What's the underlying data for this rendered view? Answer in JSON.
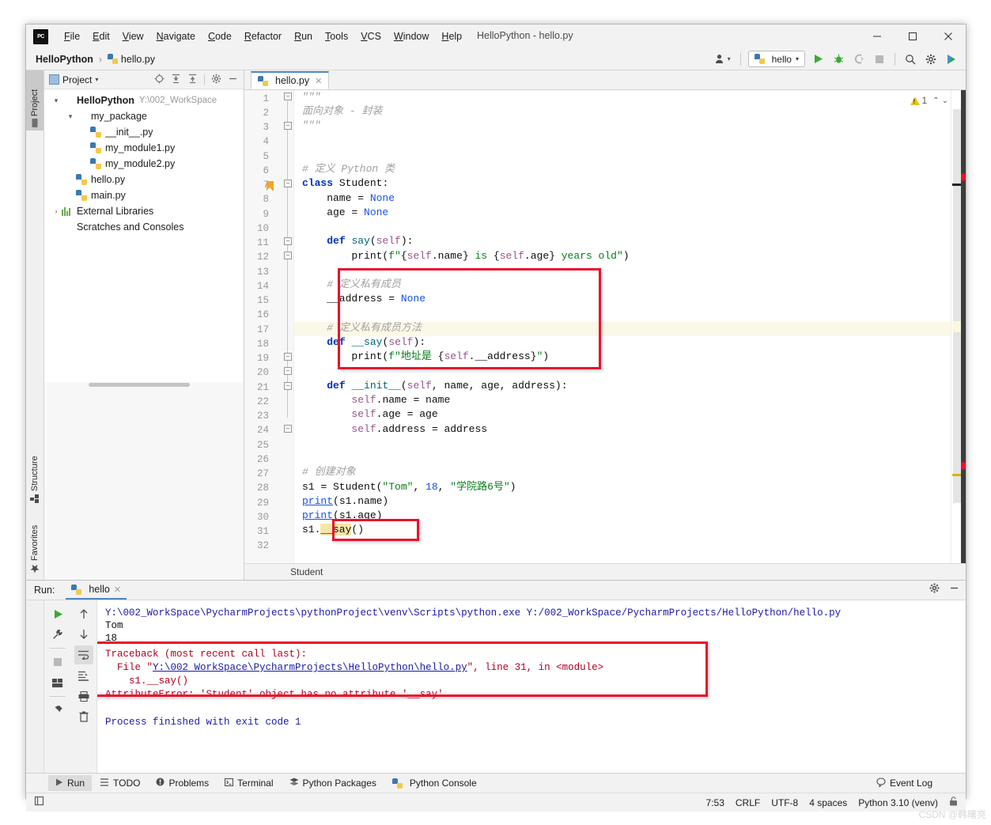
{
  "window": {
    "title": "HelloPython - hello.py",
    "logo": "pycharm-logo",
    "minimize": "–",
    "maximize": "□",
    "close": "✕"
  },
  "menubar": {
    "items": [
      "File",
      "Edit",
      "View",
      "Navigate",
      "Code",
      "Refactor",
      "Run",
      "Tools",
      "VCS",
      "Window",
      "Help"
    ]
  },
  "breadcrumb": {
    "project": "HelloPython",
    "separator": "›",
    "file": "hello.py"
  },
  "toolbar": {
    "run_config": "hello",
    "user_icon": "user-icon",
    "dropdown_caret": "▾",
    "run_icon": "run-icon",
    "debug_icon": "debug-icon",
    "coverage_icon": "run-coverage-icon",
    "stop_icon": "stop-icon",
    "search_icon": "search-icon",
    "settings_icon": "gear-icon",
    "ai_icon": "ai-assistant-icon"
  },
  "left_tool_strip": {
    "tabs": [
      {
        "label": "Project",
        "icon": "folder-icon",
        "selected": true
      },
      {
        "label": "Structure",
        "icon": "structure-icon",
        "selected": false
      },
      {
        "label": "Favorites",
        "icon": "star-icon",
        "selected": false
      }
    ]
  },
  "project_panel": {
    "title": "Project",
    "caret": "▾",
    "tools": [
      "locate-icon",
      "expand-all-icon",
      "collapse-all-icon",
      "gear-icon",
      "hide-icon"
    ],
    "tree": [
      {
        "label": "HelloPython",
        "path": "Y:\\002_WorkSpace",
        "icon": "folder-icon",
        "arrow": "▾",
        "depth": 0,
        "bold": true
      },
      {
        "label": "my_package",
        "path": "",
        "icon": "package-icon",
        "arrow": "▾",
        "depth": 1,
        "bold": false
      },
      {
        "label": "__init__.py",
        "path": "",
        "icon": "python-file-icon",
        "arrow": "",
        "depth": 2,
        "bold": false
      },
      {
        "label": "my_module1.py",
        "path": "",
        "icon": "python-file-icon",
        "arrow": "",
        "depth": 2,
        "bold": false
      },
      {
        "label": "my_module2.py",
        "path": "",
        "icon": "python-file-icon",
        "arrow": "",
        "depth": 2,
        "bold": false
      },
      {
        "label": "hello.py",
        "path": "",
        "icon": "python-file-icon",
        "arrow": "",
        "depth": 1,
        "bold": false
      },
      {
        "label": "main.py",
        "path": "",
        "icon": "python-file-icon",
        "arrow": "",
        "depth": 1,
        "bold": false
      },
      {
        "label": "External Libraries",
        "path": "",
        "icon": "libraries-icon",
        "arrow": "›",
        "depth": 0,
        "bold": false
      },
      {
        "label": "Scratches and Consoles",
        "path": "",
        "icon": "scratches-icon",
        "arrow": "",
        "depth": 0,
        "bold": false
      }
    ]
  },
  "editor": {
    "tab": {
      "label": "hello.py",
      "icon": "python-file-icon",
      "close": "✕"
    },
    "inspection": {
      "count": "1",
      "icon": "warning-triangle-icon",
      "up": "⌃",
      "down": "⌄"
    },
    "breadcrumb": "Student",
    "bookmark_line": 7,
    "highlight_line": 17,
    "lines": [
      {
        "n": 1,
        "text": "\"\"\""
      },
      {
        "n": 2,
        "text": "面向对象 - 封装"
      },
      {
        "n": 3,
        "text": "\"\"\""
      },
      {
        "n": 4,
        "text": ""
      },
      {
        "n": 5,
        "text": ""
      },
      {
        "n": 6,
        "text": "# 定义 Python 类"
      },
      {
        "n": 7,
        "text": "class Student:"
      },
      {
        "n": 8,
        "text": "    name = None"
      },
      {
        "n": 9,
        "text": "    age = None"
      },
      {
        "n": 10,
        "text": ""
      },
      {
        "n": 11,
        "text": "    def say(self):"
      },
      {
        "n": 12,
        "text": "        print(f\"{self.name} is {self.age} years old\")"
      },
      {
        "n": 13,
        "text": ""
      },
      {
        "n": 14,
        "text": "    # 定义私有成员"
      },
      {
        "n": 15,
        "text": "    __address = None"
      },
      {
        "n": 16,
        "text": ""
      },
      {
        "n": 17,
        "text": "    # 定义私有成员方法"
      },
      {
        "n": 18,
        "text": "    def __say(self):"
      },
      {
        "n": 19,
        "text": "        print(f\"地址是 {self.__address}\")"
      },
      {
        "n": 20,
        "text": ""
      },
      {
        "n": 21,
        "text": "    def __init__(self, name, age, address):"
      },
      {
        "n": 22,
        "text": "        self.name = name"
      },
      {
        "n": 23,
        "text": "        self.age = age"
      },
      {
        "n": 24,
        "text": "        self.address = address"
      },
      {
        "n": 25,
        "text": ""
      },
      {
        "n": 26,
        "text": ""
      },
      {
        "n": 27,
        "text": "# 创建对象"
      },
      {
        "n": 28,
        "text": "s1 = Student(\"Tom\", 18, \"学院路6号\")"
      },
      {
        "n": 29,
        "text": "print(s1.name)"
      },
      {
        "n": 30,
        "text": "print(s1.age)"
      },
      {
        "n": 31,
        "text": "s1.__say()"
      },
      {
        "n": 32,
        "text": ""
      }
    ]
  },
  "run_panel": {
    "label": "Run:",
    "tab": {
      "label": "hello",
      "icon": "python-icon",
      "close": "✕"
    },
    "header_tools": [
      "gear-icon",
      "hide-icon"
    ],
    "left_tools": [
      "rerun-icon",
      "wrench-icon",
      "stop-icon",
      "layout-icon",
      "pin-icon"
    ],
    "right_tools": [
      "up-arrow-icon",
      "down-arrow-icon",
      "soft-wrap-icon",
      "scroll-to-end-icon",
      "print-icon",
      "trash-icon"
    ],
    "console": [
      {
        "text": "Y:\\002_WorkSpace\\PycharmProjects\\pythonProject\\venv\\Scripts\\python.exe Y:/002_WorkSpace/PycharmProjects/HelloPython/hello.py",
        "style": "blue"
      },
      {
        "text": "Tom",
        "style": "plain"
      },
      {
        "text": "18",
        "style": "plain"
      },
      {
        "text": "Traceback (most recent call last):",
        "style": "red"
      },
      {
        "text": "  File \"Y:\\002_WorkSpace\\PycharmProjects\\HelloPython\\hello.py\", line 31, in <module>",
        "style": "red-link"
      },
      {
        "text": "    s1.__say()",
        "style": "red"
      },
      {
        "text": "AttributeError: 'Student' object has no attribute '__say'",
        "style": "red"
      },
      {
        "text": "",
        "style": "plain"
      },
      {
        "text": "Process finished with exit code 1",
        "style": "blue"
      }
    ],
    "link_text": "Y:\\002_WorkSpace\\PycharmProjects\\HelloPython\\hello.py"
  },
  "bottom_tabs": {
    "items": [
      {
        "label": "Run",
        "icon": "run-icon",
        "selected": true
      },
      {
        "label": "TODO",
        "icon": "todo-icon",
        "selected": false
      },
      {
        "label": "Problems",
        "icon": "problems-icon",
        "selected": false
      },
      {
        "label": "Terminal",
        "icon": "terminal-icon",
        "selected": false
      },
      {
        "label": "Python Packages",
        "icon": "packages-icon",
        "selected": false
      },
      {
        "label": "Python Console",
        "icon": "python-console-icon",
        "selected": false
      }
    ],
    "event_log": {
      "label": "Event Log",
      "icon": "balloon-icon"
    }
  },
  "status_bar": {
    "left_icon": "layout-toggle-icon",
    "caret_position": "7:53",
    "line_separator": "CRLF",
    "encoding": "UTF-8",
    "indent": "4 spaces",
    "interpreter": "Python 3.10 (venv)",
    "lock_icon": "unlock-icon"
  },
  "watermark": "CSDN @韩曙亮",
  "colors": {
    "accent": "#4a86c8",
    "annotation_red": "#e8112d",
    "keyword": "#0033b3",
    "string": "#067d17",
    "comment": "#a0a0a0",
    "self": "#94558d",
    "error": "#b00020",
    "link": "#1a1aa6"
  }
}
